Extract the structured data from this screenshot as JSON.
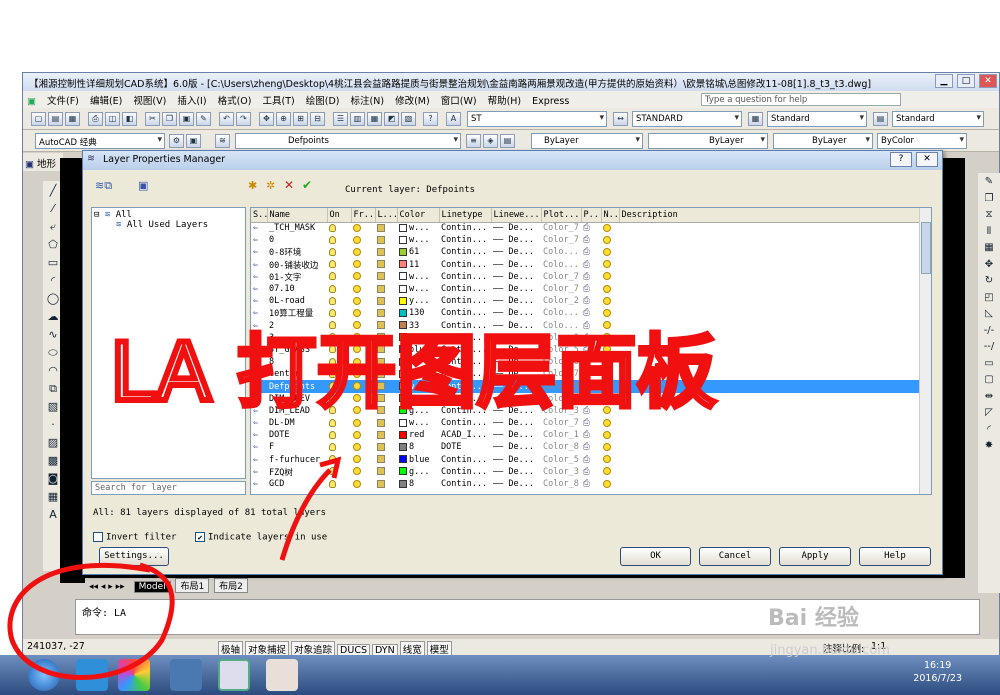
{
  "window": {
    "title": "【湘源控制性详细规划CAD系统】6.0版 - [C:\\Users\\zheng\\Desktop\\4桃江县会益路路提质与街景整治规划\\金益南路两厢景观改造(甲方提供的原始资料）\\欧景铭城\\总图修改11-08[1].8_t3_t3.dwg]"
  },
  "menubar": {
    "items": [
      "文件(F)",
      "编辑(E)",
      "视图(V)",
      "插入(I)",
      "格式(O)",
      "工具(T)",
      "绘图(D)",
      "标注(N)",
      "修改(M)",
      "窗口(W)",
      "帮助(H)",
      "Express"
    ],
    "help_placeholder": "Type a question for help"
  },
  "toolbar": {
    "text_style": "ST",
    "dim_style": "STANDARD",
    "table_style": "Standard",
    "plot_style": "Standard",
    "workspace": "AutoCAD 经典",
    "layer": "Defpoints",
    "color": "ByLayer",
    "linetype": "ByLayer",
    "lineweight": "ByLayer",
    "plotstyle": "ByColor"
  },
  "doc_tab": "地形",
  "dialog": {
    "title": "Layer Properties Manager",
    "current_layer_label": "Current layer: Defpoints",
    "tree": {
      "root": "All",
      "child": "All Used Layers"
    },
    "search_placeholder": "Search for layer",
    "columns": [
      "S..",
      "Name",
      "On",
      "Fr...",
      "L...",
      "Color",
      "Linetype",
      "Linewe...",
      "Plot...",
      "P..",
      "N..",
      "Description"
    ],
    "rows": [
      {
        "name": "_TCH_MASK",
        "color_name": "w...",
        "swatch": "#ffffff",
        "linetype": "Contin...",
        "lw": "—— De...",
        "plot": "Color_7"
      },
      {
        "name": "0",
        "color_name": "w...",
        "swatch": "#ffffff",
        "linetype": "Contin...",
        "lw": "—— De...",
        "plot": "Color_7"
      },
      {
        "name": "0-8环境",
        "color_name": "61",
        "swatch": "#9acd32",
        "linetype": "Contin...",
        "lw": "—— De...",
        "plot": "Colo..."
      },
      {
        "name": "00-铺装收边",
        "color_name": "11",
        "swatch": "#ff7f7f",
        "linetype": "Contin...",
        "lw": "—— De...",
        "plot": "Colo..."
      },
      {
        "name": "01-文字",
        "color_name": "w...",
        "swatch": "#ffffff",
        "linetype": "Contin...",
        "lw": "—— De...",
        "plot": "Color_7"
      },
      {
        "name": "07.10",
        "color_name": "w...",
        "swatch": "#ffffff",
        "linetype": "Contin...",
        "lw": "—— De...",
        "plot": "Color_7"
      },
      {
        "name": "0L-road",
        "color_name": "y...",
        "swatch": "#ffff00",
        "linetype": "Contin...",
        "lw": "—— De...",
        "plot": "Color_2"
      },
      {
        "name": "10算工程量",
        "color_name": "130",
        "swatch": "#00bfbf",
        "linetype": "Contin...",
        "lw": "—— De...",
        "plot": "Colo..."
      },
      {
        "name": "2",
        "color_name": "33",
        "swatch": "#c08050",
        "linetype": "Contin...",
        "lw": "—— De...",
        "plot": "Colo..."
      },
      {
        "name": "3",
        "color_name": "g...",
        "swatch": "#00ff00",
        "linetype": "Contin...",
        "lw": "—— De...",
        "plot": "Color_3"
      },
      {
        "name": "3T_GLASS",
        "color_name": "blue",
        "swatch": "#0000ff",
        "linetype": "Contin...",
        "lw": "—— De...",
        "plot": "Color_5"
      },
      {
        "name": "8",
        "color_name": "8",
        "swatch": "#808080",
        "linetype": "Contin...",
        "lw": "—— De...",
        "plot": "Color_8"
      },
      {
        "name": "center",
        "color_name": "w...",
        "swatch": "#ffffff",
        "linetype": "Contin...",
        "lw": "—— De...",
        "plot": "Color_7"
      },
      {
        "name": "Defpoints",
        "color_name": "w...",
        "swatch": "#ffffff",
        "linetype": "Contin...",
        "lw": "—— De...",
        "plot": "Color_7",
        "selected": true
      },
      {
        "name": "DIM_ELEV",
        "color_name": "g...",
        "swatch": "#00ff00",
        "linetype": "Contin...",
        "lw": "—— De...",
        "plot": "Color_3"
      },
      {
        "name": "DIM_LEAD",
        "color_name": "g...",
        "swatch": "#00ff00",
        "linetype": "Contin...",
        "lw": "—— De...",
        "plot": "Color_3"
      },
      {
        "name": "DL-DM",
        "color_name": "w...",
        "swatch": "#ffffff",
        "linetype": "Contin...",
        "lw": "—— De...",
        "plot": "Color_7"
      },
      {
        "name": "DOTE",
        "color_name": "red",
        "swatch": "#ff0000",
        "linetype": "ACAD_I...",
        "lw": "—— De...",
        "plot": "Color_1"
      },
      {
        "name": "F",
        "color_name": "8",
        "swatch": "#808080",
        "linetype": "DOTE",
        "lw": "—— De...",
        "plot": "Color_8"
      },
      {
        "name": "f-furhucer",
        "color_name": "blue",
        "swatch": "#0000ff",
        "linetype": "Contin...",
        "lw": "—— De...",
        "plot": "Color_5"
      },
      {
        "name": "FZQ树",
        "color_name": "g...",
        "swatch": "#00ff00",
        "linetype": "Contin...",
        "lw": "—— De...",
        "plot": "Color_3"
      },
      {
        "name": "GCD",
        "color_name": "8",
        "swatch": "#808080",
        "linetype": "Contin...",
        "lw": "—— De...",
        "plot": "Color_8"
      }
    ],
    "summary": "All: 81 layers displayed of 81 total layers",
    "invert_filter": "Invert filter",
    "indicate_layers": "Indicate layers in use",
    "settings": "Settings...",
    "ok": "OK",
    "cancel": "Cancel",
    "apply": "Apply",
    "help": "Help"
  },
  "layout_tabs": [
    "Model",
    "布局1",
    "布局2"
  ],
  "command": {
    "text": "命令: LA"
  },
  "status": {
    "coords": "241037, -27",
    "toggles": [
      "极轴",
      "对象捕捉",
      "对象追踪",
      "DUCS",
      "DYN",
      "线宽",
      "模型"
    ],
    "scale_label": "注释比例:",
    "scale_value": "1:1"
  },
  "taskbar": {
    "time": "16:19",
    "date": "2016/7/23"
  },
  "annotation": {
    "text": "LA 打开图层面板"
  },
  "watermark": {
    "brand": "Bai 经验",
    "url": "jingyan.baidu.com"
  }
}
